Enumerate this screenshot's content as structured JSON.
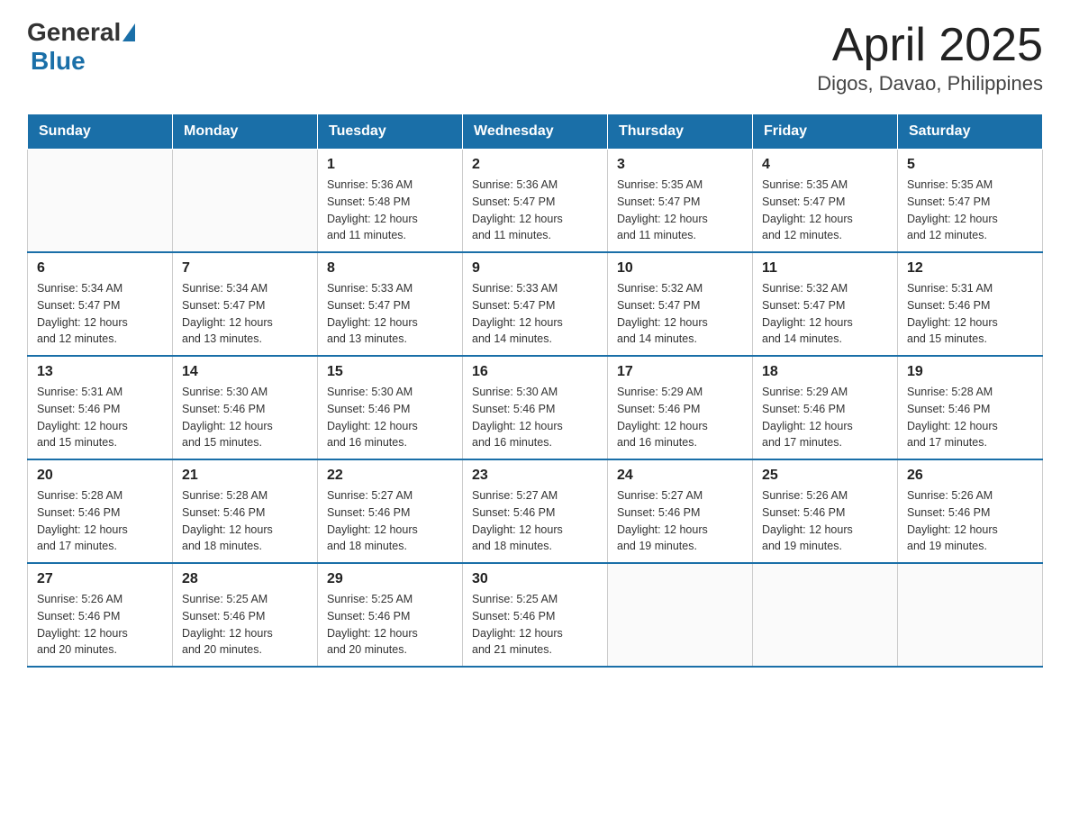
{
  "header": {
    "logo_general": "General",
    "logo_blue": "Blue",
    "title": "April 2025",
    "subtitle": "Digos, Davao, Philippines"
  },
  "days_of_week": [
    "Sunday",
    "Monday",
    "Tuesday",
    "Wednesday",
    "Thursday",
    "Friday",
    "Saturday"
  ],
  "weeks": [
    [
      {
        "day": "",
        "info": ""
      },
      {
        "day": "",
        "info": ""
      },
      {
        "day": "1",
        "info": "Sunrise: 5:36 AM\nSunset: 5:48 PM\nDaylight: 12 hours\nand 11 minutes."
      },
      {
        "day": "2",
        "info": "Sunrise: 5:36 AM\nSunset: 5:47 PM\nDaylight: 12 hours\nand 11 minutes."
      },
      {
        "day": "3",
        "info": "Sunrise: 5:35 AM\nSunset: 5:47 PM\nDaylight: 12 hours\nand 11 minutes."
      },
      {
        "day": "4",
        "info": "Sunrise: 5:35 AM\nSunset: 5:47 PM\nDaylight: 12 hours\nand 12 minutes."
      },
      {
        "day": "5",
        "info": "Sunrise: 5:35 AM\nSunset: 5:47 PM\nDaylight: 12 hours\nand 12 minutes."
      }
    ],
    [
      {
        "day": "6",
        "info": "Sunrise: 5:34 AM\nSunset: 5:47 PM\nDaylight: 12 hours\nand 12 minutes."
      },
      {
        "day": "7",
        "info": "Sunrise: 5:34 AM\nSunset: 5:47 PM\nDaylight: 12 hours\nand 13 minutes."
      },
      {
        "day": "8",
        "info": "Sunrise: 5:33 AM\nSunset: 5:47 PM\nDaylight: 12 hours\nand 13 minutes."
      },
      {
        "day": "9",
        "info": "Sunrise: 5:33 AM\nSunset: 5:47 PM\nDaylight: 12 hours\nand 14 minutes."
      },
      {
        "day": "10",
        "info": "Sunrise: 5:32 AM\nSunset: 5:47 PM\nDaylight: 12 hours\nand 14 minutes."
      },
      {
        "day": "11",
        "info": "Sunrise: 5:32 AM\nSunset: 5:47 PM\nDaylight: 12 hours\nand 14 minutes."
      },
      {
        "day": "12",
        "info": "Sunrise: 5:31 AM\nSunset: 5:46 PM\nDaylight: 12 hours\nand 15 minutes."
      }
    ],
    [
      {
        "day": "13",
        "info": "Sunrise: 5:31 AM\nSunset: 5:46 PM\nDaylight: 12 hours\nand 15 minutes."
      },
      {
        "day": "14",
        "info": "Sunrise: 5:30 AM\nSunset: 5:46 PM\nDaylight: 12 hours\nand 15 minutes."
      },
      {
        "day": "15",
        "info": "Sunrise: 5:30 AM\nSunset: 5:46 PM\nDaylight: 12 hours\nand 16 minutes."
      },
      {
        "day": "16",
        "info": "Sunrise: 5:30 AM\nSunset: 5:46 PM\nDaylight: 12 hours\nand 16 minutes."
      },
      {
        "day": "17",
        "info": "Sunrise: 5:29 AM\nSunset: 5:46 PM\nDaylight: 12 hours\nand 16 minutes."
      },
      {
        "day": "18",
        "info": "Sunrise: 5:29 AM\nSunset: 5:46 PM\nDaylight: 12 hours\nand 17 minutes."
      },
      {
        "day": "19",
        "info": "Sunrise: 5:28 AM\nSunset: 5:46 PM\nDaylight: 12 hours\nand 17 minutes."
      }
    ],
    [
      {
        "day": "20",
        "info": "Sunrise: 5:28 AM\nSunset: 5:46 PM\nDaylight: 12 hours\nand 17 minutes."
      },
      {
        "day": "21",
        "info": "Sunrise: 5:28 AM\nSunset: 5:46 PM\nDaylight: 12 hours\nand 18 minutes."
      },
      {
        "day": "22",
        "info": "Sunrise: 5:27 AM\nSunset: 5:46 PM\nDaylight: 12 hours\nand 18 minutes."
      },
      {
        "day": "23",
        "info": "Sunrise: 5:27 AM\nSunset: 5:46 PM\nDaylight: 12 hours\nand 18 minutes."
      },
      {
        "day": "24",
        "info": "Sunrise: 5:27 AM\nSunset: 5:46 PM\nDaylight: 12 hours\nand 19 minutes."
      },
      {
        "day": "25",
        "info": "Sunrise: 5:26 AM\nSunset: 5:46 PM\nDaylight: 12 hours\nand 19 minutes."
      },
      {
        "day": "26",
        "info": "Sunrise: 5:26 AM\nSunset: 5:46 PM\nDaylight: 12 hours\nand 19 minutes."
      }
    ],
    [
      {
        "day": "27",
        "info": "Sunrise: 5:26 AM\nSunset: 5:46 PM\nDaylight: 12 hours\nand 20 minutes."
      },
      {
        "day": "28",
        "info": "Sunrise: 5:25 AM\nSunset: 5:46 PM\nDaylight: 12 hours\nand 20 minutes."
      },
      {
        "day": "29",
        "info": "Sunrise: 5:25 AM\nSunset: 5:46 PM\nDaylight: 12 hours\nand 20 minutes."
      },
      {
        "day": "30",
        "info": "Sunrise: 5:25 AM\nSunset: 5:46 PM\nDaylight: 12 hours\nand 21 minutes."
      },
      {
        "day": "",
        "info": ""
      },
      {
        "day": "",
        "info": ""
      },
      {
        "day": "",
        "info": ""
      }
    ]
  ]
}
